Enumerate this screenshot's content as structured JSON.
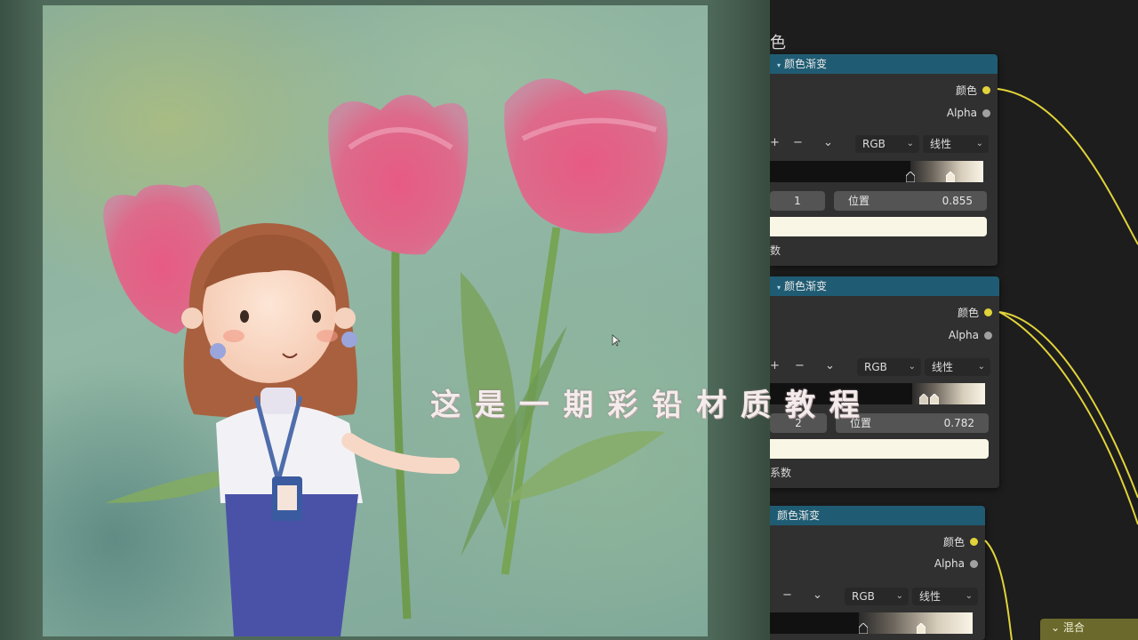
{
  "subtitle": "这 是 一 期 彩 铅 材 质 教 程",
  "editor": {
    "title_partial": "色",
    "nodes": [
      {
        "title": "颜色渐变",
        "outputs": [
          "颜色",
          "Alpha"
        ],
        "toolbar": {
          "add": "+",
          "remove": "−",
          "menu": "⌄",
          "color_mode": "RGB",
          "interpolation": "线性"
        },
        "stop_index": "1",
        "position_label": "位置",
        "position_value": "0.855",
        "fac_label": "系数",
        "fac_visible": "数"
      },
      {
        "title": "颜色渐变",
        "outputs": [
          "颜色",
          "Alpha"
        ],
        "toolbar": {
          "add": "+",
          "remove": "−",
          "menu": "⌄",
          "color_mode": "RGB",
          "interpolation": "线性"
        },
        "stop_index": "2",
        "position_label": "位置",
        "position_value": "0.782",
        "fac_label": "系数",
        "fac_visible": "系数"
      },
      {
        "title": "颜色渐变",
        "outputs": [
          "颜色",
          "Alpha"
        ],
        "toolbar": {
          "add": "+",
          "remove": "−",
          "menu": "⌄",
          "color_mode": "RGB",
          "interpolation": "线性"
        }
      }
    ],
    "mix_node": {
      "title": "混合",
      "collapse": "⌄"
    }
  },
  "colors": {
    "node_header": "#1f5c73",
    "socket_color": "#e1d33a",
    "socket_alpha": "#a1a1a1",
    "wire": "#e1d33a",
    "mix_header": "#6b6a2c"
  }
}
